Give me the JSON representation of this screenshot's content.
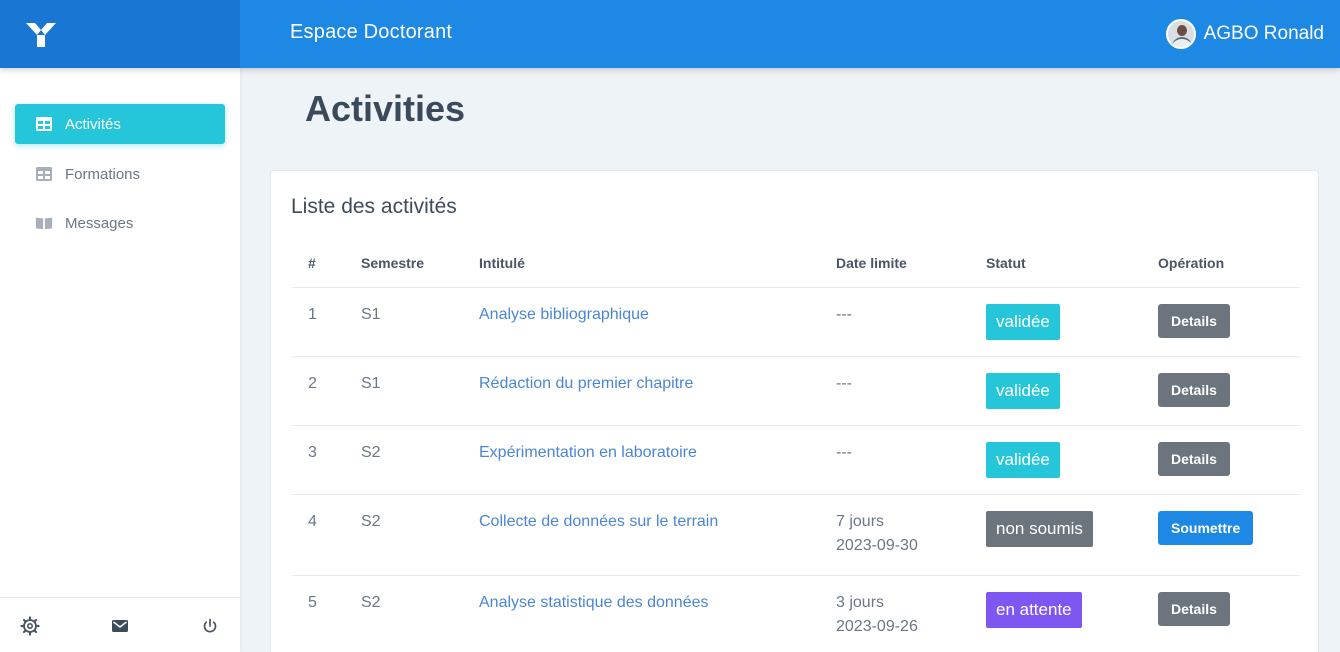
{
  "header": {
    "app_title": "Espace Doctorant",
    "user_name": "AGBO Ronald",
    "accent_color": "#1e88e5"
  },
  "sidebar": {
    "items": [
      {
        "label": "Activités",
        "icon": "table-icon",
        "active": true
      },
      {
        "label": "Formations",
        "icon": "table-icon",
        "active": false
      },
      {
        "label": "Messages",
        "icon": "book-icon",
        "active": false
      }
    ],
    "footer_icons": [
      "gear-icon",
      "mail-icon",
      "power-icon"
    ]
  },
  "page": {
    "title": "Activities"
  },
  "card": {
    "title": "Liste des activités",
    "columns": [
      "#",
      "Semestre",
      "Intitulé",
      "Date limite",
      "Statut",
      "Opération"
    ],
    "rows": [
      {
        "num": "1",
        "semestre": "S1",
        "intitule": "Analyse bibliographique",
        "date_line1": "---",
        "date_line2": "",
        "statut": "validée",
        "statut_color": "#26c6da",
        "operation": "Details"
      },
      {
        "num": "2",
        "semestre": "S1",
        "intitule": "Rédaction du premier chapitre",
        "date_line1": "---",
        "date_line2": "",
        "statut": "validée",
        "statut_color": "#26c6da",
        "operation": "Details"
      },
      {
        "num": "3",
        "semestre": "S2",
        "intitule": "Expérimentation en laboratoire",
        "date_line1": "---",
        "date_line2": "",
        "statut": "validée",
        "statut_color": "#26c6da",
        "operation": "Details"
      },
      {
        "num": "4",
        "semestre": "S2",
        "intitule": "Collecte de données sur le terrain",
        "date_line1": "7 jours",
        "date_line2": "2023-09-30",
        "statut": "non soumis",
        "statut_color": "#6c757d",
        "operation": "Soumettre"
      },
      {
        "num": "5",
        "semestre": "S2",
        "intitule": "Analyse statistique des données",
        "date_line1": "3 jours",
        "date_line2": "2023-09-26",
        "statut": "en attente",
        "statut_color": "#7e57f2",
        "operation": "Details"
      }
    ]
  }
}
